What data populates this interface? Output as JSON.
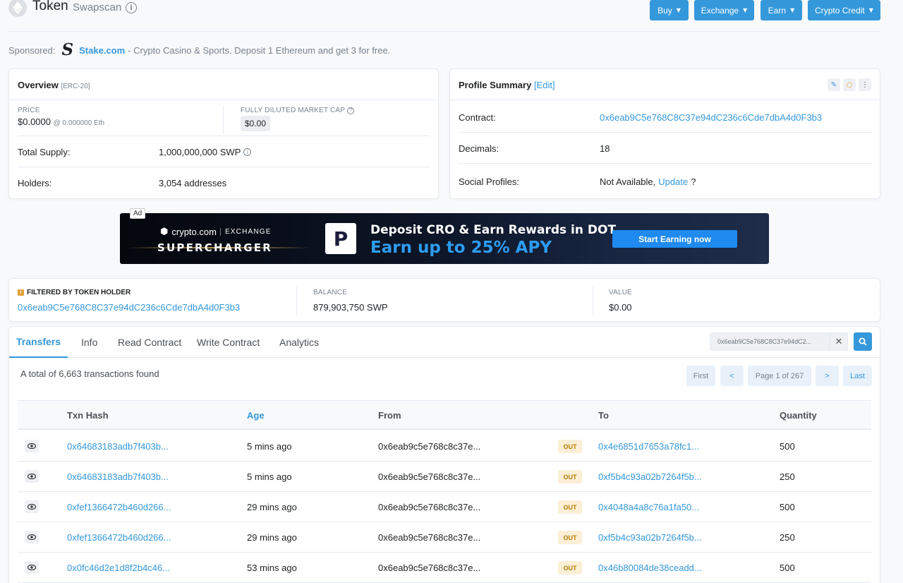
{
  "header": {
    "title": "Token",
    "subtitle": "Swapscan",
    "info_glyph": "i",
    "buttons": [
      "Buy",
      "Exchange",
      "Earn",
      "Crypto Credit"
    ]
  },
  "sponsored": {
    "label": "Sponsored:",
    "logo_glyph": "S",
    "name": "Stake.com",
    "text": "- Crypto Casino & Sports. Deposit 1 Ethereum and get 3 for free."
  },
  "overview": {
    "title": "Overview",
    "tag": "[ERC-20]",
    "price_label": "PRICE",
    "price": "$0.0000",
    "price_eth": "@ 0.000000 Eth",
    "market_cap_label": "FULLY DILUTED MARKET CAP",
    "market_cap": "$0.00",
    "total_supply_label": "Total Supply:",
    "total_supply": "1,000,000,000 SWP",
    "holders_label": "Holders:",
    "holders": "3,054 addresses"
  },
  "profile": {
    "title": "Profile Summary",
    "edit": "[Edit]",
    "contract_label": "Contract:",
    "contract": "0x6eab9C5e768C8C37e94dC236c6Cde7dbA4d0F3b3",
    "decimals_label": "Decimals:",
    "decimals": "18",
    "social_label": "Social Profiles:",
    "social_na": "Not Available,",
    "social_update": "Update",
    "social_q": "?"
  },
  "ad": {
    "tag": "Ad",
    "brand": "crypto.com",
    "exchange": "EXCHANGE",
    "supercharger": "SUPERCHARGER",
    "logo_glyph": "P",
    "headline": "Deposit CRO & Earn Rewards in DOT",
    "subline": "Earn up to 25% APY",
    "cta": "Start Earning now"
  },
  "filter": {
    "label": "FILTERED BY TOKEN HOLDER",
    "address": "0x6eab9C5e768C8C37e94dC236c6Cde7dbA4d0F3b3",
    "balance_label": "BALANCE",
    "balance": "879,903,750 SWP",
    "value_label": "VALUE",
    "value": "$0.00"
  },
  "tabs": [
    "Transfers",
    "Info",
    "Read Contract",
    "Write Contract",
    "Analytics"
  ],
  "search": {
    "value": "0x6eab9C5e768C8C37e94dC2..."
  },
  "total_text": "A total of 6,663 transactions found",
  "pagination": {
    "first": "First",
    "prev": "<",
    "page": "Page 1 of 267",
    "next": ">",
    "last": "Last"
  },
  "table": {
    "headers": [
      "Txn Hash",
      "Age",
      "From",
      "To",
      "Quantity"
    ],
    "rows": [
      {
        "hash": "0x64683183adb7f403b...",
        "age": "5 mins ago",
        "from": "0x6eab9c5e768c8c37e...",
        "dir": "OUT",
        "to": "0x4e6851d7653a78fc1...",
        "qty": "500"
      },
      {
        "hash": "0x64683183adb7f403b...",
        "age": "5 mins ago",
        "from": "0x6eab9c5e768c8c37e...",
        "dir": "OUT",
        "to": "0xf5b4c93a02b7264f5b...",
        "qty": "250"
      },
      {
        "hash": "0xfef1366472b460d266...",
        "age": "29 mins ago",
        "from": "0x6eab9c5e768c8c37e...",
        "dir": "OUT",
        "to": "0x4048a4a8c76a1fa50...",
        "qty": "500"
      },
      {
        "hash": "0xfef1366472b460d266...",
        "age": "29 mins ago",
        "from": "0x6eab9c5e768c8c37e...",
        "dir": "OUT",
        "to": "0xf5b4c93a02b7264f5b...",
        "qty": "250"
      },
      {
        "hash": "0x0fc46d2e1d8f2b4c46...",
        "age": "53 mins ago",
        "from": "0x6eab9c5e768c8c37e...",
        "dir": "OUT",
        "to": "0x46b80084de38ceadd...",
        "qty": "500"
      }
    ]
  },
  "colors": {
    "accent": "#3498db",
    "out_badge_bg": "#fbefd6",
    "out_badge_text": "#b47d00"
  },
  "icons": [
    "ethereum-logo-icon",
    "info-icon",
    "chevron-down-icon",
    "question-icon",
    "pencil-icon",
    "circle-icon",
    "more-vertical-icon",
    "close-icon",
    "search-icon",
    "eye-icon"
  ]
}
